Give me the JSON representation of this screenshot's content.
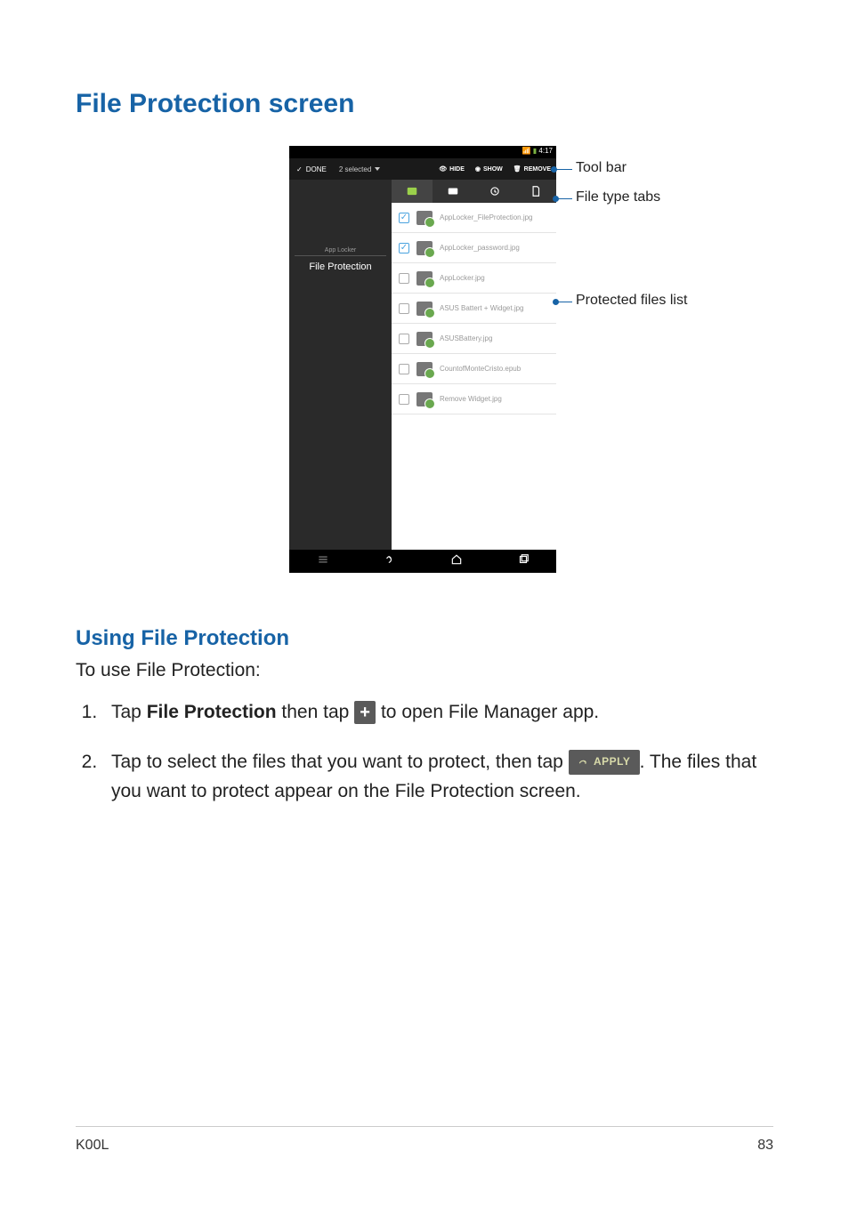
{
  "headings": {
    "title": "File Protection screen",
    "subtitle": "Using File Protection"
  },
  "callouts": {
    "toolbar": "Tool bar",
    "tabs": "File type tabs",
    "list": "Protected files list"
  },
  "screenshot": {
    "status_time": "4:17",
    "toolbar": {
      "done": "DONE",
      "selected": "2 selected",
      "hide": "HIDE",
      "show": "SHOW",
      "remove": "REMOVE"
    },
    "sidebar": {
      "app": "App Locker",
      "section": "File Protection"
    },
    "files": [
      {
        "name": "AppLocker_FileProtection.jpg",
        "checked": true
      },
      {
        "name": "AppLocker_password.jpg",
        "checked": true
      },
      {
        "name": "AppLocker.jpg",
        "checked": false
      },
      {
        "name": "ASUS Battert + Widget.jpg",
        "checked": false
      },
      {
        "name": "ASUSBattery.jpg",
        "checked": false
      },
      {
        "name": "CountofMonteCristo.epub",
        "checked": false
      },
      {
        "name": "Remove Widget.jpg",
        "checked": false
      }
    ]
  },
  "instructions": {
    "intro": "To use File Protection:",
    "step1_a": "Tap ",
    "step1_b": "File Protection",
    "step1_c": " then tap ",
    "step1_d": " to open File Manager app.",
    "step2_a": "Tap to select the files that you want to protect, then tap ",
    "step2_b": ". The files that you want to protect appear on the File Protection screen.",
    "apply_label": "APPLY",
    "plus_label": "+"
  },
  "footer": {
    "model": "K00L",
    "page": "83"
  }
}
